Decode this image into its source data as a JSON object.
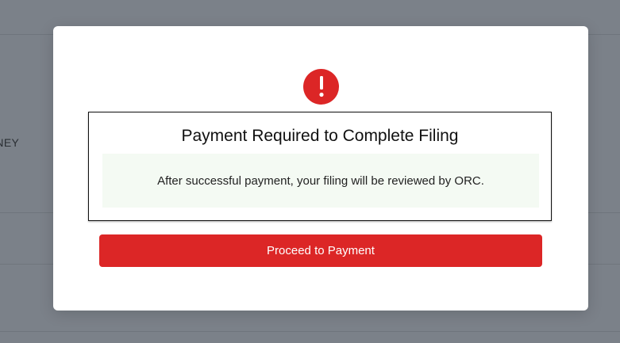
{
  "background": {
    "partial_label": "RNEY"
  },
  "modal": {
    "icon": "exclamation-circle-icon",
    "title": "Payment Required to Complete Filing",
    "info_text": "After successful payment, your filing will be reviewed by ORC.",
    "button_label": "Proceed to Payment"
  },
  "colors": {
    "accent": "#dc2626",
    "info_panel": "#f4faf3",
    "overlay": "#7b8189"
  }
}
